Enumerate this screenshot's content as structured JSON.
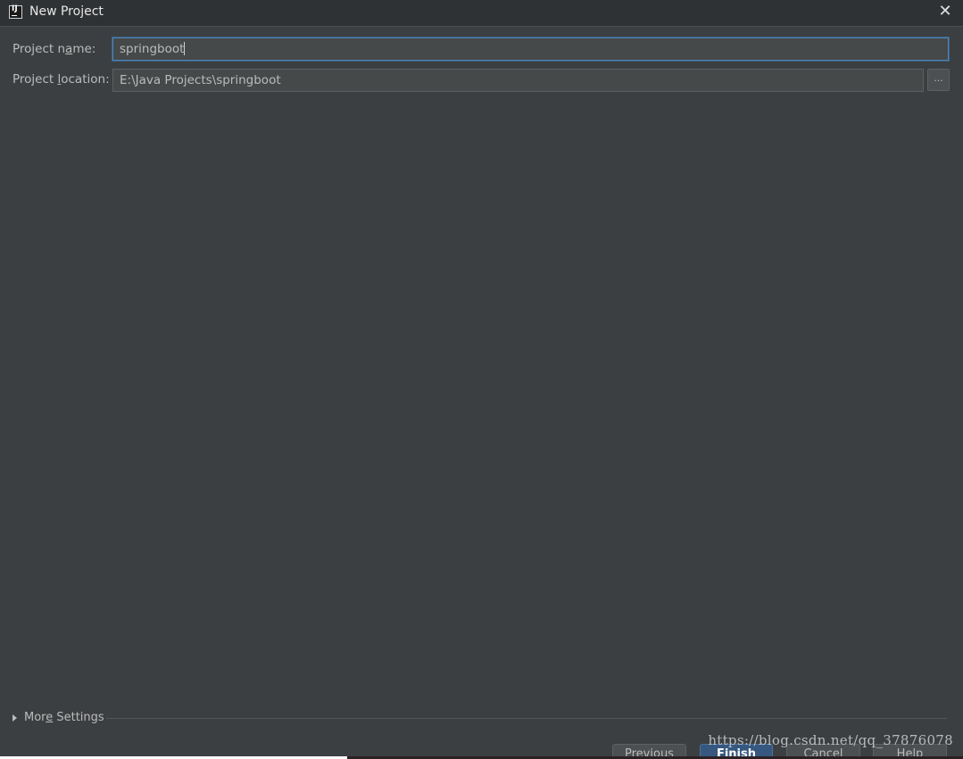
{
  "window": {
    "title": "New Project",
    "app_icon_text": "IJ"
  },
  "form": {
    "project_name": {
      "label_pre": "Project n",
      "label_mnemonic": "a",
      "label_post": "me:",
      "value": "springboot"
    },
    "project_location": {
      "label_pre": "Project ",
      "label_mnemonic": "l",
      "label_post": "ocation:",
      "value": "E:\\Java Projects\\springboot",
      "browse_label": "..."
    }
  },
  "more_settings": {
    "label_pre": "Mor",
    "label_mnemonic": "e",
    "label_post": " Settings"
  },
  "buttons": {
    "previous": "Previous",
    "finish": "Finish",
    "cancel": "Cancel",
    "help": "Help"
  },
  "watermark": "https://blog.csdn.net/qq_37876078"
}
